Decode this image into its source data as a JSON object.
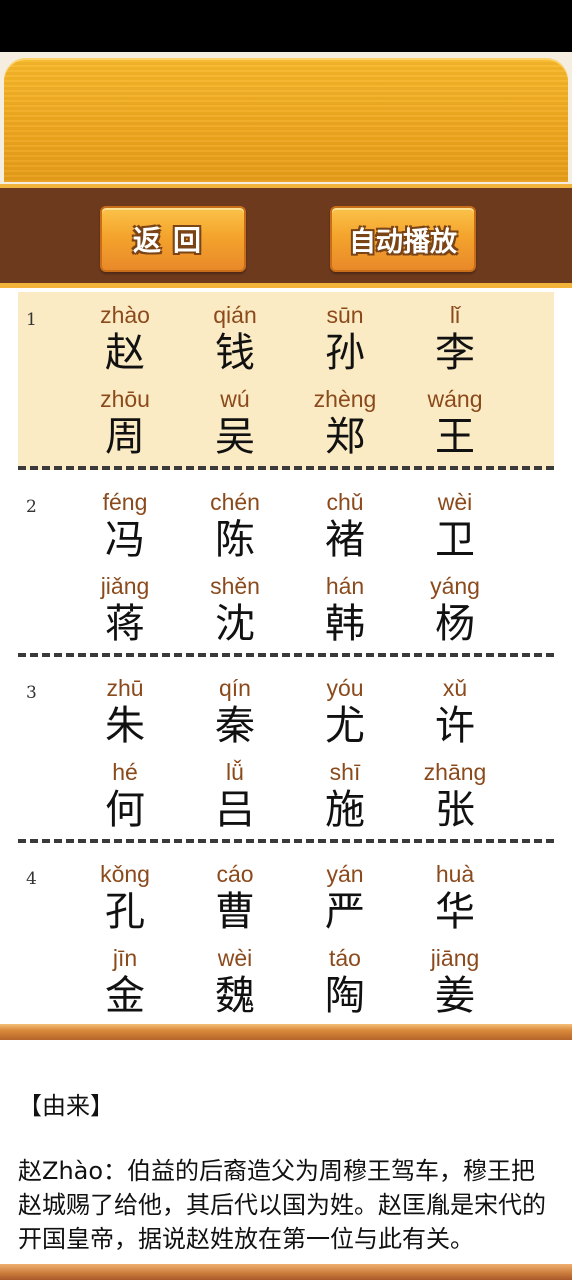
{
  "toolbar": {
    "back_label": "返回",
    "autoplay_label": "自动播放"
  },
  "groups": [
    {
      "num": "1",
      "cells": [
        {
          "py": "zhào",
          "hz": "赵"
        },
        {
          "py": "qián",
          "hz": "钱"
        },
        {
          "py": "sūn",
          "hz": "孙"
        },
        {
          "py": "lǐ",
          "hz": "李"
        },
        {
          "py": "zhōu",
          "hz": "周"
        },
        {
          "py": "wú",
          "hz": "吴"
        },
        {
          "py": "zhèng",
          "hz": "郑"
        },
        {
          "py": "wáng",
          "hz": "王"
        }
      ]
    },
    {
      "num": "2",
      "cells": [
        {
          "py": "féng",
          "hz": "冯"
        },
        {
          "py": "chén",
          "hz": "陈"
        },
        {
          "py": "chǔ",
          "hz": "褚"
        },
        {
          "py": "wèi",
          "hz": "卫"
        },
        {
          "py": "jiǎng",
          "hz": "蒋"
        },
        {
          "py": "shěn",
          "hz": "沈"
        },
        {
          "py": "hán",
          "hz": "韩"
        },
        {
          "py": "yáng",
          "hz": "杨"
        }
      ]
    },
    {
      "num": "3",
      "cells": [
        {
          "py": "zhū",
          "hz": "朱"
        },
        {
          "py": "qín",
          "hz": "秦"
        },
        {
          "py": "yóu",
          "hz": "尤"
        },
        {
          "py": "xǔ",
          "hz": "许"
        },
        {
          "py": "hé",
          "hz": "何"
        },
        {
          "py": "lǚ",
          "hz": "吕"
        },
        {
          "py": "shī",
          "hz": "施"
        },
        {
          "py": "zhāng",
          "hz": "张"
        }
      ]
    },
    {
      "num": "4",
      "cells": [
        {
          "py": "kǒng",
          "hz": "孔"
        },
        {
          "py": "cáo",
          "hz": "曹"
        },
        {
          "py": "yán",
          "hz": "严"
        },
        {
          "py": "huà",
          "hz": "华"
        },
        {
          "py": "jīn",
          "hz": "金"
        },
        {
          "py": "wèi",
          "hz": "魏"
        },
        {
          "py": "táo",
          "hz": "陶"
        },
        {
          "py": "jiāng",
          "hz": "姜"
        }
      ]
    }
  ],
  "info": {
    "title": "【由来】",
    "text": "赵Zhào：伯益的后裔造父为周穆王驾车，穆王把赵城赐了给他，其后代以国为姓。赵匡胤是宋代的开国皇帝，据说赵姓放在第一位与此有关。"
  }
}
